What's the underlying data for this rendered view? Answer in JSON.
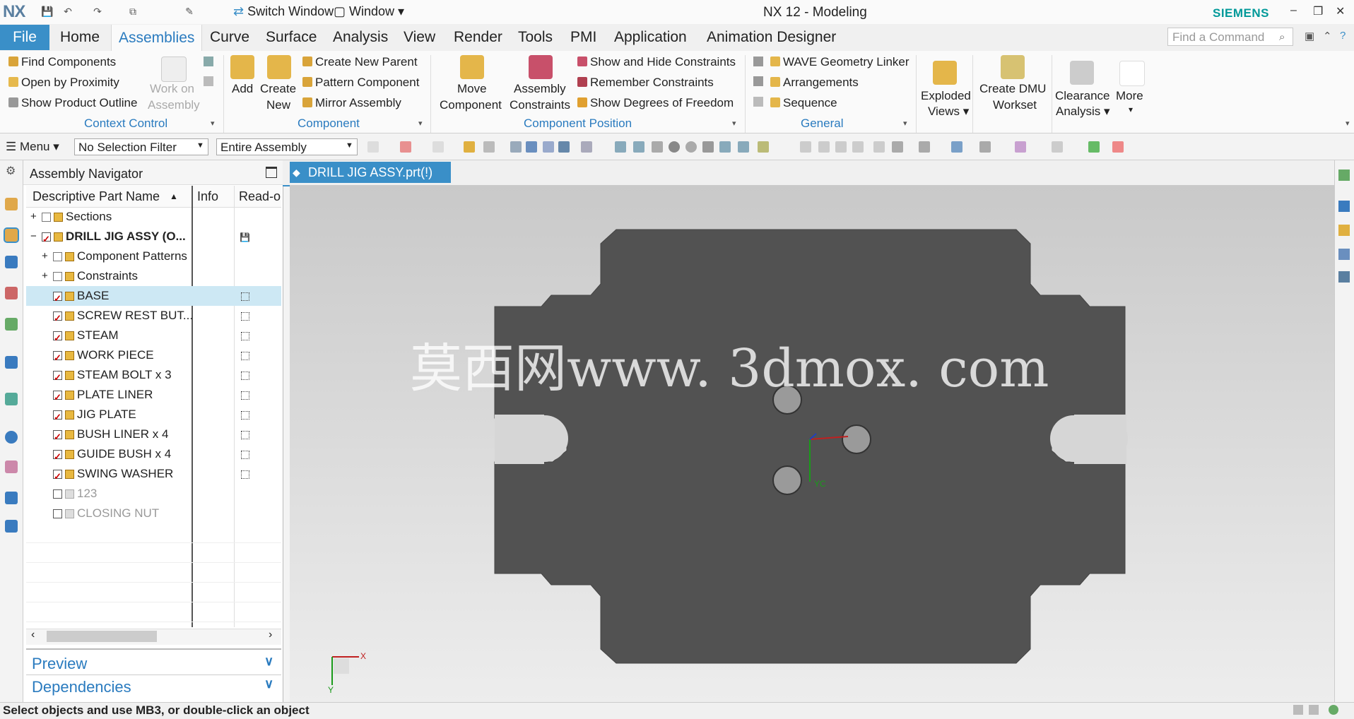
{
  "titlebar": {
    "logo": "NX",
    "switch_window": "Switch Window",
    "window_menu": "Window ▾",
    "title": "NX 12 - Modeling",
    "brand": "SIEMENS",
    "min_btn": "–",
    "restore_btn": "❐",
    "close_btn": "✕"
  },
  "tabs": {
    "file": "File",
    "items": [
      "Home",
      "Assemblies",
      "Curve",
      "Surface",
      "Analysis",
      "View",
      "Render",
      "Tools",
      "PMI",
      "Application",
      "Animation Designer"
    ],
    "active": "Assemblies",
    "find_placeholder": "Find a Command"
  },
  "ribbon": {
    "context_control": {
      "label": "Context Control",
      "find_components": "Find Components",
      "open_by_proximity": "Open by Proximity",
      "show_product_outline": "Show Product Outline",
      "work_on": "Work on",
      "assembly": "Assembly"
    },
    "component": {
      "label": "Component",
      "add": "Add",
      "create": "Create",
      "new": "New",
      "create_new_parent": "Create New Parent",
      "pattern_component": "Pattern Component",
      "mirror_assembly": "Mirror Assembly"
    },
    "component_position": {
      "label": "Component Position",
      "move": "Move",
      "component": "Component",
      "assembly": "Assembly",
      "constraints": "Constraints",
      "show_hide_constraints": "Show and Hide Constraints",
      "remember_constraints": "Remember Constraints",
      "show_dof": "Show Degrees of Freedom"
    },
    "general": {
      "label": "General",
      "wave_linker": "WAVE Geometry Linker",
      "arrangements": "Arrangements",
      "sequence": "Sequence"
    },
    "exploded": "Exploded",
    "views": "Views ▾",
    "create_dmu": "Create DMU",
    "workset": "Workset",
    "clearance": "Clearance",
    "analysis": "Analysis ▾",
    "more": "More",
    "more_arrow": "▾"
  },
  "selection_bar": {
    "menu": "Menu ▾",
    "filter": "No Selection Filter",
    "scope": "Entire Assembly"
  },
  "navigator": {
    "title": "Assembly Navigator",
    "columns": [
      "Descriptive Part Name",
      "Info",
      "Read-or"
    ],
    "rows": [
      {
        "name": "Sections",
        "level": 0,
        "expand": "+",
        "checked": false,
        "kind": "folder"
      },
      {
        "name": "DRILL JIG ASSY (O...",
        "level": 0,
        "expand": "−",
        "checked": true,
        "kind": "root"
      },
      {
        "name": "Component Patterns",
        "level": 1,
        "expand": "+",
        "checked": false,
        "kind": "folder"
      },
      {
        "name": "Constraints",
        "level": 1,
        "expand": "+",
        "checked": false,
        "kind": "folder"
      },
      {
        "name": "BASE",
        "level": 1,
        "checked": true,
        "kind": "part",
        "selected": true
      },
      {
        "name": "SCREW REST BUT...",
        "level": 1,
        "checked": true,
        "kind": "part"
      },
      {
        "name": "STEAM",
        "level": 1,
        "checked": true,
        "kind": "part"
      },
      {
        "name": "WORK PIECE",
        "level": 1,
        "checked": true,
        "kind": "part"
      },
      {
        "name": "STEAM BOLT x 3",
        "level": 1,
        "checked": true,
        "kind": "part"
      },
      {
        "name": "PLATE LINER",
        "level": 1,
        "checked": true,
        "kind": "part"
      },
      {
        "name": "JIG PLATE",
        "level": 1,
        "checked": true,
        "kind": "part"
      },
      {
        "name": "BUSH LINER x 4",
        "level": 1,
        "checked": true,
        "kind": "part"
      },
      {
        "name": "GUIDE BUSH x 4",
        "level": 1,
        "checked": true,
        "kind": "part"
      },
      {
        "name": "SWING WASHER",
        "level": 1,
        "checked": true,
        "kind": "part"
      },
      {
        "name": "123",
        "level": 1,
        "checked": false,
        "kind": "disabled"
      },
      {
        "name": "CLOSING NUT",
        "level": 1,
        "checked": false,
        "kind": "disabled"
      }
    ],
    "preview": "Preview",
    "dependencies": "Dependencies"
  },
  "document_tab": "DRILL JIG ASSY.prt(!)",
  "graphics": {
    "watermark": "莫西网www. 3dmox. com",
    "triad_x": "X",
    "triad_y": "Y",
    "wcs_yc": "YC",
    "part_color": "#525252",
    "background_top": "#c9c9c9",
    "background_bottom": "#ededed"
  },
  "status": "Select objects and use MB3, or double-click an object",
  "colors": {
    "accent": "#3a8fc8",
    "brand": "#009999"
  }
}
